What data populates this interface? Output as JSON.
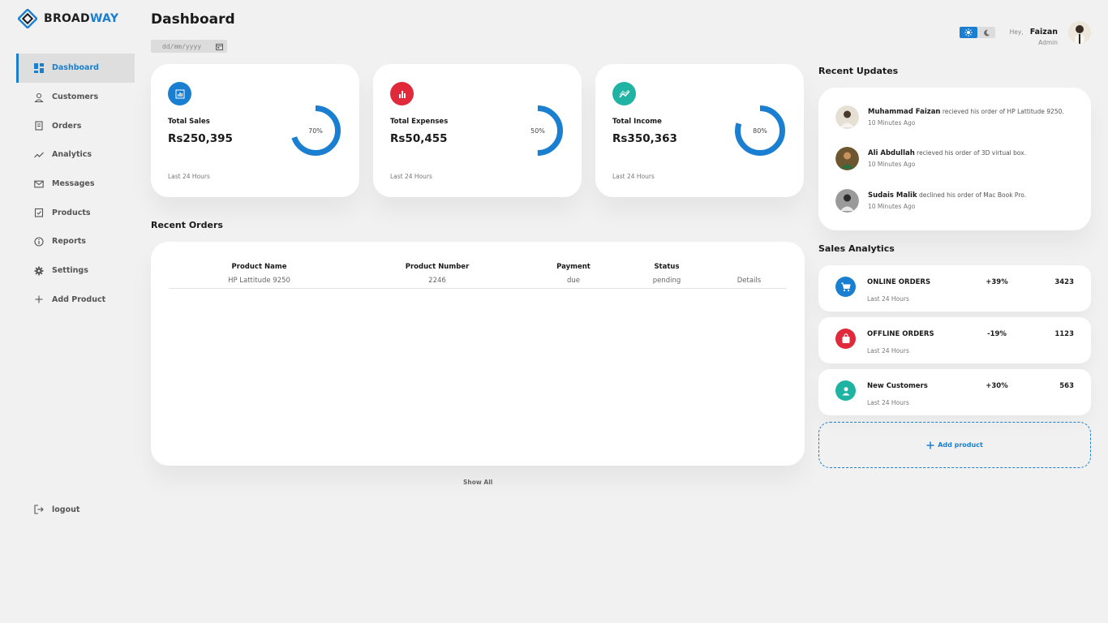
{
  "brand": {
    "name_dark": "BROAD",
    "name_accent": "WAY",
    "accent_color": "#1a7fd0"
  },
  "sidebar": {
    "items": [
      {
        "label": "Dashboard",
        "icon": "dashboard-grid-icon",
        "active": true
      },
      {
        "label": "Customers",
        "icon": "user-icon"
      },
      {
        "label": "Orders",
        "icon": "receipt-icon"
      },
      {
        "label": "Analytics",
        "icon": "trend-icon"
      },
      {
        "label": "Messages",
        "icon": "mail-icon"
      },
      {
        "label": "Products",
        "icon": "box-icon"
      },
      {
        "label": "Reports",
        "icon": "info-icon"
      },
      {
        "label": "Settings",
        "icon": "gear-icon"
      },
      {
        "label": "Add Product",
        "icon": "plus-icon"
      }
    ],
    "logout_label": "logout"
  },
  "header": {
    "title": "Dashboard",
    "date_placeholder": "dd/mm/yyyy",
    "greeting": "Hey,",
    "user_name": "Faizan",
    "user_role": "Admin"
  },
  "stats": [
    {
      "label": "Total Sales",
      "value": "Rs250,395",
      "percent_text": "70%",
      "percent": 70,
      "footer": "Last 24 Hours",
      "icon_color": "#1a7fd0",
      "icon": "bar-chart-icon"
    },
    {
      "label": "Total Expenses",
      "value": "Rs50,455",
      "percent_text": "50%",
      "percent": 50,
      "footer": "Last 24 Hours",
      "icon_color": "#e0293a",
      "icon": "bar-chart-icon"
    },
    {
      "label": "Total Income",
      "value": "Rs350,363",
      "percent_text": "80%",
      "percent": 80,
      "footer": "Last 24 Hours",
      "icon_color": "#1fb3a3",
      "icon": "trend-up-icon"
    }
  ],
  "ring_color": "#1a7fd0",
  "recent_orders": {
    "title": "Recent Orders",
    "columns": [
      "Product Name",
      "Product Number",
      "Payment",
      "Status",
      ""
    ],
    "rows": [
      [
        "HP Lattitude 9250",
        "2246",
        "due",
        "pending",
        "Details"
      ]
    ],
    "show_all": "Show All"
  },
  "recent_updates": {
    "title": "Recent Updates",
    "items": [
      {
        "name": "Muhammad Faizan",
        "text": "recieved his order of HP Lattitude 9250.",
        "time": "10 Minutes Ago",
        "avatar_color": "#d9d2c5"
      },
      {
        "name": "Ali Abdullah",
        "text": "recieved his order of 3D virtual box.",
        "time": "10 Minutes Ago",
        "avatar_color": "#7a5a36"
      },
      {
        "name": "Sudais Malik",
        "text": "declined his order of Mac Book Pro.",
        "time": "10 Minutes Ago",
        "avatar_color": "#3a3a3a"
      }
    ]
  },
  "sales_analytics": {
    "title": "Sales Analytics",
    "items": [
      {
        "title": "ONLINE ORDERS",
        "sub": "Last 24 Hours",
        "pct": "+39%",
        "count": "3423",
        "icon": "cart-icon",
        "color": "#1a7fd0"
      },
      {
        "title": "OFFLINE ORDERS",
        "sub": "Last 24 Hours",
        "pct": "-19%",
        "count": "1123",
        "icon": "shopping-bag-icon",
        "color": "#e0293a"
      },
      {
        "title": "New Customers",
        "sub": "Last 24 Hours",
        "pct": "+30%",
        "count": "563",
        "icon": "person-icon",
        "color": "#1fb3a3"
      }
    ],
    "add_label": "Add product"
  }
}
